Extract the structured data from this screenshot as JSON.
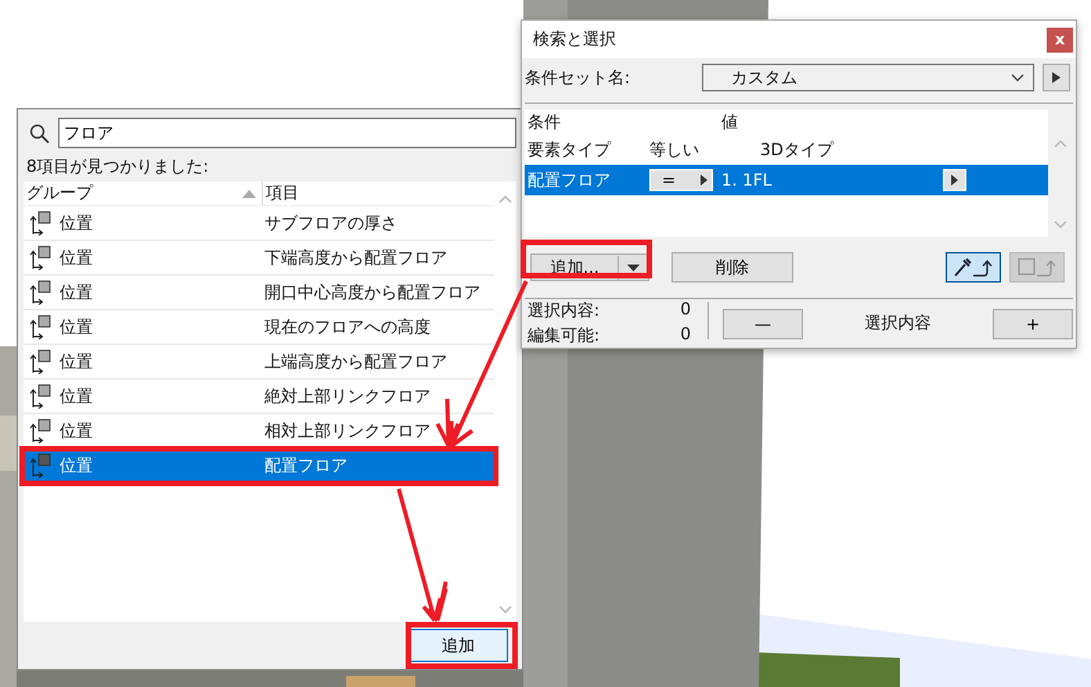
{
  "search_panel": {
    "search": {
      "value": "フロア"
    },
    "result_count": "8項目が見つかりました:",
    "columns": [
      "グループ",
      "項目"
    ],
    "rows": [
      {
        "group": "位置",
        "item": "サブフロアの厚さ",
        "selected": false
      },
      {
        "group": "位置",
        "item": "下端高度から配置フロア",
        "selected": false
      },
      {
        "group": "位置",
        "item": "開口中心高度から配置フロア",
        "selected": false
      },
      {
        "group": "位置",
        "item": "現在のフロアへの高度",
        "selected": false
      },
      {
        "group": "位置",
        "item": "上端高度から配置フロア",
        "selected": false
      },
      {
        "group": "位置",
        "item": "絶対上部リンクフロア",
        "selected": false
      },
      {
        "group": "位置",
        "item": "相対上部リンクフロア",
        "selected": false
      },
      {
        "group": "位置",
        "item": "配置フロア",
        "selected": true
      }
    ],
    "add_button": "追加"
  },
  "dialog": {
    "title": "検索と選択",
    "close": "x",
    "criteria_set": {
      "label": "条件セット名:",
      "value": "カスタム"
    },
    "table": {
      "columns": [
        "条件",
        "値"
      ],
      "rows": [
        {
          "kind": "text",
          "criterion": "要素タイプ",
          "operator": "等しい",
          "value": "3Dタイプ",
          "selected": false
        },
        {
          "kind": "control",
          "criterion": "配置フロア",
          "operator": "=",
          "value": "1. 1FL",
          "selected": true
        }
      ]
    },
    "add_button": "追加...",
    "delete_button": "削除",
    "tools": [
      {
        "kind": "eyedropper",
        "selected": true,
        "disabled": false
      },
      {
        "kind": "marquee",
        "selected": false,
        "disabled": true
      }
    ],
    "selection_label": "選択内容:",
    "selection_count": "0",
    "editable_label": "編集可能:",
    "editable_count": "0",
    "minus_button": "—",
    "selection_title": "選択内容",
    "plus_button": "+"
  }
}
